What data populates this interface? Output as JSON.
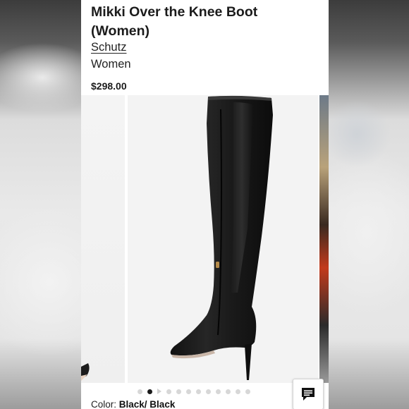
{
  "product": {
    "title": "Mikki Over the Knee Boot (Women)",
    "brand": "Schutz",
    "department": "Women",
    "price": "$298.00"
  },
  "carousel": {
    "image_count": 12,
    "active_index": 1,
    "video_indicator_index": 2
  },
  "color": {
    "label": "Color:",
    "value": "Black/ Black"
  },
  "icons": {
    "chat": "chat-bubble-icon"
  },
  "colors": {
    "text": "#1b1b1b",
    "dot_active": "#1a1a1a",
    "dot_inactive": "#d7d7d7"
  }
}
